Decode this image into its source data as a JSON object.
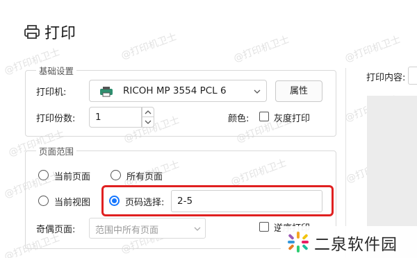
{
  "window": {
    "title": "打印"
  },
  "basic_group": {
    "label": "基础设置",
    "printer_label": "打印机:",
    "printer_value": "RICOH MP 3554 PCL 6",
    "properties_button": "属性",
    "copies_label": "打印份数:",
    "copies_value": "1",
    "color_label": "颜色:",
    "grayscale_label": "灰度打印"
  },
  "page_range_group": {
    "label": "页面范围",
    "options": [
      {
        "label": "当前页面",
        "selected": false
      },
      {
        "label": "所有页面",
        "selected": false
      },
      {
        "label": "当前视图",
        "selected": false
      },
      {
        "label": "页码选择:",
        "selected": true
      }
    ],
    "page_selection_value": "2-5",
    "odd_even_label": "奇偶页面:",
    "odd_even_value": "范围中所有页面",
    "reverse_label": "逆序打印"
  },
  "preview": {
    "label": "打印内容:"
  },
  "watermark": {
    "text": "@打印机卫士"
  },
  "brand": {
    "text": "二泉软件园"
  },
  "colors": {
    "accent": "#1677ff",
    "highlight": "#e02020"
  }
}
